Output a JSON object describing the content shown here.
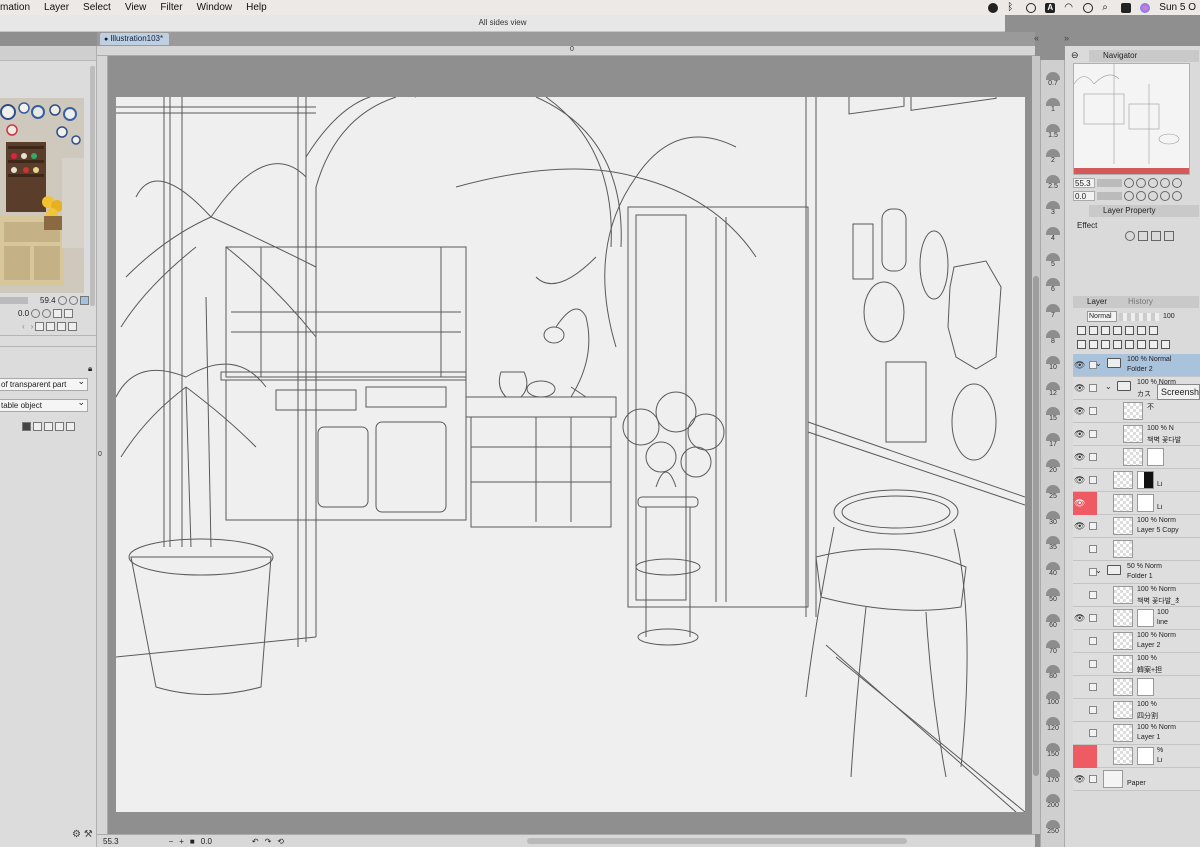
{
  "menubar": {
    "items": [
      "mation",
      "Layer",
      "Select",
      "View",
      "Filter",
      "Window",
      "Help"
    ],
    "clock": "Sun 5 O",
    "status_icons": [
      "creative-cloud-icon",
      "bluetooth-icon",
      "play-icon",
      "input-source-icon",
      "wifi-icon",
      "time-machine-icon",
      "spotlight-icon",
      "control-center-icon",
      "siri-icon"
    ],
    "input_source": "A"
  },
  "window": {
    "subtitle": "All sides view"
  },
  "document": {
    "tab_label": "Illustration103*"
  },
  "ruler": {
    "top_zero": "0",
    "left_zero": "0"
  },
  "left_panel": {
    "zoom_value": "59.4",
    "rotate_value": "0.0",
    "select_1": "of transparent part",
    "select_2": "table object"
  },
  "status": {
    "zoom": "55.3",
    "rotate": "0.0"
  },
  "zoom_strip": [
    "0.7",
    "1",
    "1.5",
    "2",
    "2.5",
    "3",
    "4",
    "5",
    "6",
    "7",
    "8",
    "10",
    "12",
    "15",
    "17",
    "20",
    "25",
    "30",
    "35",
    "40",
    "50",
    "60",
    "70",
    "80",
    "100",
    "120",
    "150",
    "170",
    "200",
    "250"
  ],
  "navigator": {
    "title": "Navigator",
    "zoom": "55.3",
    "rotate": "0.0"
  },
  "layer_property": {
    "title": "Layer Property",
    "effect_label": "Effect"
  },
  "layer_panel": {
    "tab_layer": "Layer",
    "tab_history": "History",
    "blend_mode": "Normal",
    "opacity": "100"
  },
  "layers": [
    {
      "pct": "100 %  Normal",
      "name": "Folder 2",
      "type": "folder",
      "selected": true,
      "visible": true,
      "red": false,
      "indent": 0
    },
    {
      "pct": "100 %  Norm",
      "name": "カス",
      "type": "folder",
      "selected": false,
      "visible": true,
      "red": false,
      "indent": 1
    },
    {
      "pct": "不",
      "name": "",
      "type": "layer",
      "selected": false,
      "visible": true,
      "red": false,
      "indent": 2
    },
    {
      "pct": "100 %  N",
      "name": "책벽 꽃다발",
      "type": "layer",
      "selected": false,
      "visible": true,
      "red": false,
      "indent": 2
    },
    {
      "pct": "",
      "name": "",
      "type": "mask",
      "selected": false,
      "visible": true,
      "red": false,
      "indent": 2
    },
    {
      "pct": "",
      "name": "Li",
      "type": "mask-dark",
      "selected": false,
      "visible": true,
      "red": false,
      "indent": 1
    },
    {
      "pct": "",
      "name": "Li",
      "type": "mask",
      "selected": false,
      "visible": true,
      "red": true,
      "indent": 1
    },
    {
      "pct": "100 %  Norm",
      "name": "Layer 5 Copy",
      "type": "layer",
      "selected": false,
      "visible": true,
      "red": false,
      "indent": 1
    },
    {
      "pct": "",
      "name": "",
      "type": "layer",
      "selected": false,
      "visible": false,
      "red": false,
      "indent": 1
    },
    {
      "pct": "50 %  Norm",
      "name": "Folder 1",
      "type": "folder",
      "selected": false,
      "visible": false,
      "red": false,
      "indent": 0
    },
    {
      "pct": "100 %  Norm",
      "name": "책벽 꽃다발_최",
      "type": "layer",
      "selected": false,
      "visible": false,
      "red": false,
      "indent": 1
    },
    {
      "pct": "100",
      "name": "line",
      "type": "mask",
      "selected": false,
      "visible": true,
      "red": false,
      "indent": 1
    },
    {
      "pct": "100 %  Norm",
      "name": "Layer 2",
      "type": "layer",
      "selected": false,
      "visible": false,
      "red": false,
      "indent": 1
    },
    {
      "pct": "100 %",
      "name": "韓案+担",
      "type": "layer",
      "selected": false,
      "visible": false,
      "red": false,
      "indent": 1
    },
    {
      "pct": "",
      "name": "",
      "type": "mask",
      "selected": false,
      "visible": false,
      "red": false,
      "indent": 1
    },
    {
      "pct": "100 %",
      "name": "四分割",
      "type": "layer",
      "selected": false,
      "visible": false,
      "red": false,
      "indent": 1
    },
    {
      "pct": "100 %  Norm",
      "name": "Layer 1",
      "type": "layer",
      "selected": false,
      "visible": false,
      "red": false,
      "indent": 1
    },
    {
      "pct": "%",
      "name": "Li",
      "type": "mask",
      "selected": false,
      "visible": false,
      "red": true,
      "indent": 1
    },
    {
      "pct": "",
      "name": "Paper",
      "type": "paper",
      "selected": false,
      "visible": true,
      "red": false,
      "indent": 0
    }
  ],
  "tooltip": "Screensh",
  "colors": {
    "accent": "#a9c3dd",
    "red_flag": "#ee5b63",
    "canvas_bg": "#8f8f8f",
    "paper": "#efefef"
  }
}
